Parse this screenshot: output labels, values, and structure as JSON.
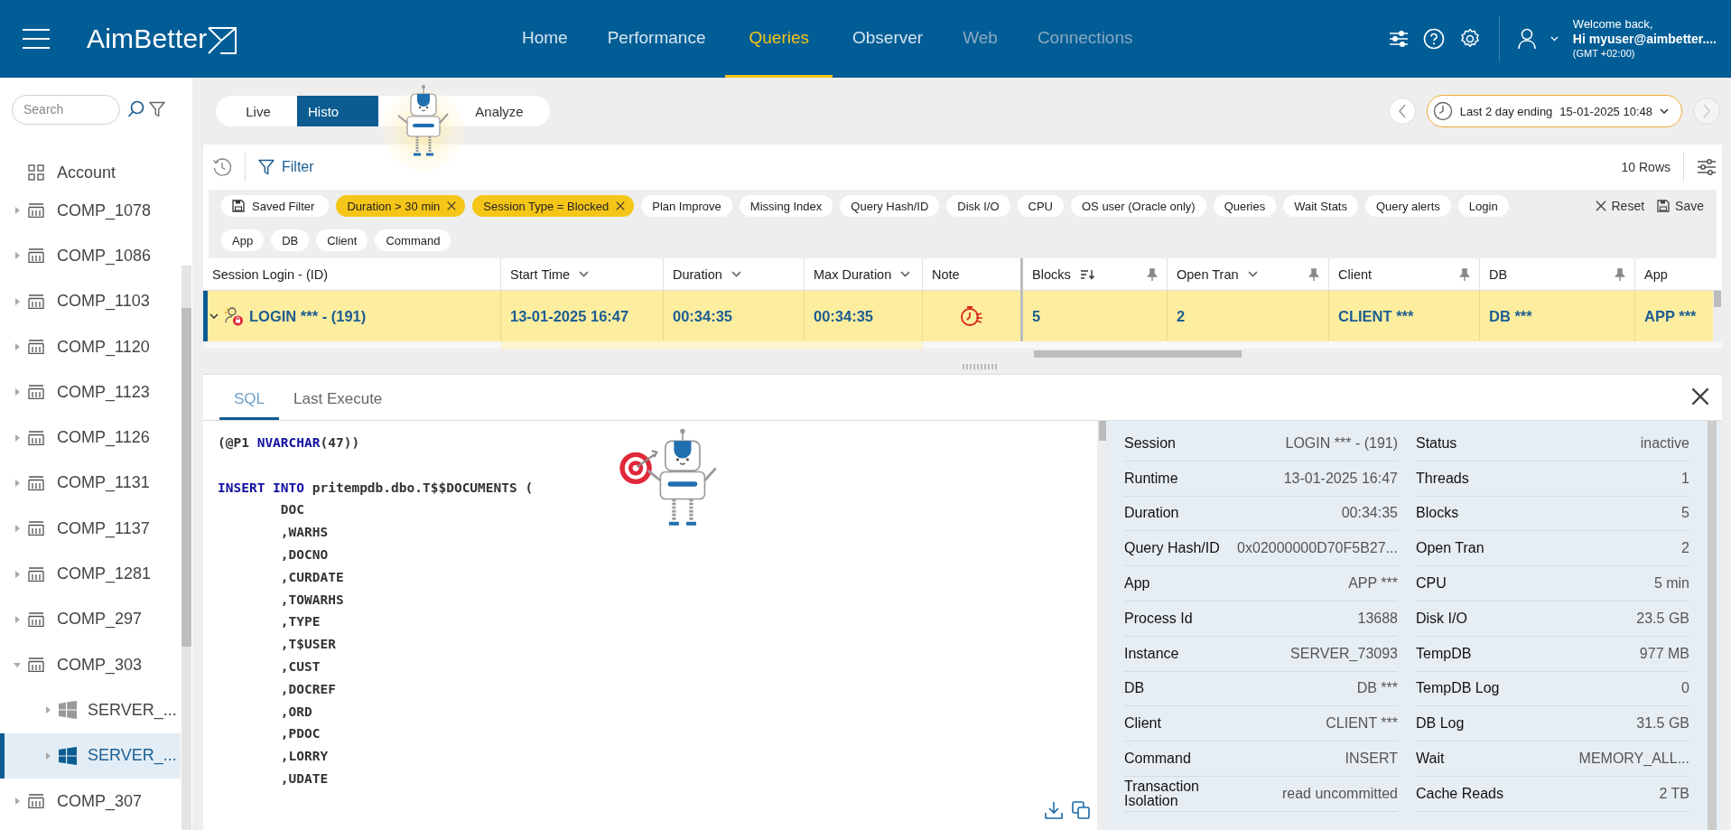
{
  "header": {
    "logo": "AimBetter",
    "nav": [
      {
        "label": "Home",
        "selected": false,
        "disabled": false
      },
      {
        "label": "Performance",
        "selected": false,
        "disabled": false
      },
      {
        "label": "Queries",
        "selected": true,
        "disabled": false
      },
      {
        "label": "Observer",
        "selected": false,
        "disabled": false
      },
      {
        "label": "Web",
        "selected": false,
        "disabled": true
      },
      {
        "label": "Connections",
        "selected": false,
        "disabled": true
      }
    ],
    "user": {
      "greeting": "Welcome back,",
      "name": "Hi myuser@aimbetter....",
      "timezone": "(GMT +02:00)"
    }
  },
  "sidebar": {
    "search": {
      "placeholder": "Search"
    },
    "items": [
      {
        "label": "Account",
        "kind": "account",
        "selected": false
      },
      {
        "label": "COMP_1078",
        "kind": "company",
        "expanded": false,
        "selected": false
      },
      {
        "label": "COMP_1086",
        "kind": "company",
        "expanded": false,
        "selected": false
      },
      {
        "label": "COMP_1103",
        "kind": "company",
        "expanded": false,
        "selected": false
      },
      {
        "label": "COMP_1120",
        "kind": "company",
        "expanded": false,
        "selected": false
      },
      {
        "label": "COMP_1123",
        "kind": "company",
        "expanded": false,
        "selected": false
      },
      {
        "label": "COMP_1126",
        "kind": "company",
        "expanded": false,
        "selected": false
      },
      {
        "label": "COMP_1131",
        "kind": "company",
        "expanded": false,
        "selected": false
      },
      {
        "label": "COMP_1137",
        "kind": "company",
        "expanded": false,
        "selected": false
      },
      {
        "label": "COMP_1281",
        "kind": "company",
        "expanded": false,
        "selected": false
      },
      {
        "label": "COMP_297",
        "kind": "company",
        "expanded": false,
        "selected": false
      },
      {
        "label": "COMP_303",
        "kind": "company",
        "expanded": true,
        "selected": false,
        "children": [
          {
            "label": "SERVER_...",
            "kind": "server",
            "expanded": false,
            "selected": false
          },
          {
            "label": "SERVER_...",
            "kind": "server",
            "expanded": false,
            "selected": true
          }
        ]
      },
      {
        "label": "COMP_307",
        "kind": "company",
        "expanded": false,
        "selected": false
      }
    ]
  },
  "mode_tabs": [
    {
      "label": "Live",
      "selected": false
    },
    {
      "label": "Histo",
      "selected": true
    },
    {
      "label": "Analyze",
      "selected": false
    }
  ],
  "time_range": {
    "label": "Last 2 day ending",
    "value": "15-01-2025 10:48"
  },
  "filter": {
    "label": "Filter",
    "row_count": "10 Rows",
    "reset": "Reset",
    "save": "Save",
    "chips": [
      {
        "label": "Saved Filter",
        "kind": "saved"
      },
      {
        "label": "Duration > 30 min",
        "kind": "active"
      },
      {
        "label": "Session Type = Blocked",
        "kind": "active"
      },
      {
        "label": "Plan Improve",
        "kind": "option"
      },
      {
        "label": "Missing Index",
        "kind": "option"
      },
      {
        "label": "Query Hash/ID",
        "kind": "option"
      },
      {
        "label": "Disk I/O",
        "kind": "option"
      },
      {
        "label": "CPU",
        "kind": "option"
      },
      {
        "label": "OS user (Oracle only)",
        "kind": "option"
      },
      {
        "label": "Queries",
        "kind": "option"
      },
      {
        "label": "Wait Stats",
        "kind": "option"
      },
      {
        "label": "Query alerts",
        "kind": "option"
      },
      {
        "label": "Login",
        "kind": "option"
      },
      {
        "label": "App",
        "kind": "option"
      },
      {
        "label": "DB",
        "kind": "option"
      },
      {
        "label": "Client",
        "kind": "option"
      },
      {
        "label": "Command",
        "kind": "option"
      }
    ]
  },
  "table": {
    "columns": [
      {
        "label": "Session Login - (ID)",
        "kind": "session",
        "dropdown": false,
        "sorted": false,
        "pin": false
      },
      {
        "label": "Start Time",
        "kind": "text",
        "dropdown": true,
        "sorted": false,
        "pin": false
      },
      {
        "label": "Duration",
        "kind": "text",
        "dropdown": true,
        "sorted": false,
        "pin": false
      },
      {
        "label": "Max Duration",
        "kind": "text",
        "dropdown": true,
        "sorted": false,
        "pin": false
      },
      {
        "label": "Note",
        "kind": "note",
        "dropdown": false,
        "sorted": false,
        "pin": false
      },
      {
        "label": "Blocks",
        "kind": "text",
        "dropdown": false,
        "sorted": true,
        "pin": true
      },
      {
        "label": "Open Tran",
        "kind": "text",
        "dropdown": true,
        "sorted": false,
        "pin": true
      },
      {
        "label": "Client",
        "kind": "text",
        "dropdown": false,
        "sorted": false,
        "pin": true
      },
      {
        "label": "DB",
        "kind": "text",
        "dropdown": false,
        "sorted": false,
        "pin": true
      },
      {
        "label": "App",
        "kind": "text",
        "dropdown": false,
        "sorted": false,
        "pin": false
      }
    ],
    "rows": [
      {
        "selected": true,
        "expanded": true,
        "cells": [
          "LOGIN *** - (191)",
          "13-01-2025 16:47",
          "00:34:35",
          "00:34:35",
          "",
          "5",
          "2",
          "CLIENT ***",
          "DB ***",
          "APP ***"
        ]
      }
    ]
  },
  "details": {
    "tabs": [
      {
        "label": "SQL",
        "selected": true
      },
      {
        "label": "Last Execute",
        "selected": false
      }
    ],
    "sql": [
      [
        {
          "text": "(@P1 ",
          "kind": "plain"
        },
        {
          "text": "NVARCHAR",
          "kind": "keyword"
        },
        {
          "text": "(47))",
          "kind": "plain"
        }
      ],
      [
        {
          "text": "INSERT INTO",
          "kind": "keyword",
          "space_before": true
        },
        {
          "text": " pritempdb.dbo.T$$DOCUMENTS (",
          "kind": "plain"
        }
      ],
      [
        {
          "text": "        DOC",
          "kind": "plain"
        }
      ],
      [
        {
          "text": "        ,WARHS",
          "kind": "plain"
        }
      ],
      [
        {
          "text": "        ,DOCNO",
          "kind": "plain"
        }
      ],
      [
        {
          "text": "        ,CURDATE",
          "kind": "plain"
        }
      ],
      [
        {
          "text": "        ,TOWARHS",
          "kind": "plain"
        }
      ],
      [
        {
          "text": "        ,TYPE",
          "kind": "plain"
        }
      ],
      [
        {
          "text": "        ,T$USER",
          "kind": "plain"
        }
      ],
      [
        {
          "text": "        ,CUST",
          "kind": "plain"
        }
      ],
      [
        {
          "text": "        ,DOCREF",
          "kind": "plain"
        }
      ],
      [
        {
          "text": "        ,ORD",
          "kind": "plain"
        }
      ],
      [
        {
          "text": "        ,PDOC",
          "kind": "plain"
        }
      ],
      [
        {
          "text": "        ,LORRY",
          "kind": "plain"
        }
      ],
      [
        {
          "text": "        ,UDATE",
          "kind": "plain"
        }
      ]
    ],
    "left": [
      {
        "label": "Session",
        "value": "LOGIN *** - (191)"
      },
      {
        "label": "Runtime",
        "value": "13-01-2025 16:47"
      },
      {
        "label": "Duration",
        "value": "00:34:35"
      },
      {
        "label": "Query Hash/ID",
        "value": "0x02000000D70F5B27..."
      },
      {
        "label": "App",
        "value": "APP ***"
      },
      {
        "label": "Process Id",
        "value": "13688"
      },
      {
        "label": "Instance",
        "value": "SERVER_73093"
      },
      {
        "label": "DB",
        "value": "DB ***"
      },
      {
        "label": "Client",
        "value": "CLIENT ***"
      },
      {
        "label": "Command",
        "value": "INSERT"
      },
      {
        "label": "Transaction Isolation",
        "value": "read uncommitted"
      }
    ],
    "right": [
      {
        "label": "Status",
        "value": "inactive"
      },
      {
        "label": "Threads",
        "value": "1"
      },
      {
        "label": "Blocks",
        "value": "5"
      },
      {
        "label": "Open Tran",
        "value": "2"
      },
      {
        "label": "CPU",
        "value": "5 min"
      },
      {
        "label": "Disk I/O",
        "value": "23.5 GB"
      },
      {
        "label": "TempDB",
        "value": "977 MB"
      },
      {
        "label": "TempDB Log",
        "value": "0"
      },
      {
        "label": "DB Log",
        "value": "31.5 GB"
      },
      {
        "label": "Wait",
        "value": "MEMORY_ALL..."
      },
      {
        "label": "Cache Reads",
        "value": "2 TB"
      }
    ]
  }
}
